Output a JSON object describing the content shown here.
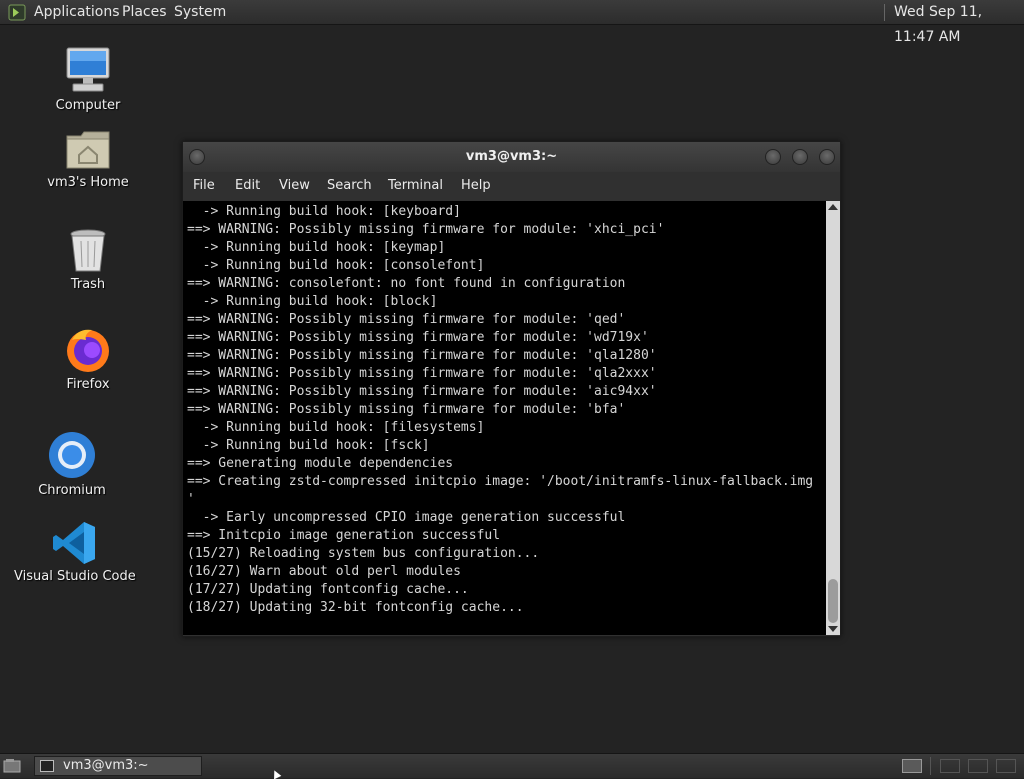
{
  "top_panel": {
    "menus": [
      "Applications",
      "Places",
      "System"
    ],
    "clock": "Wed Sep 11, 11:47 AM"
  },
  "desktop": {
    "icons": [
      {
        "label": "Computer",
        "icon": "computer-icon"
      },
      {
        "label": "vm3's Home",
        "icon": "home-folder-icon"
      },
      {
        "label": "Trash",
        "icon": "trash-icon"
      },
      {
        "label": "Firefox",
        "icon": "firefox-icon"
      },
      {
        "label": "Chromium",
        "icon": "chromium-icon"
      },
      {
        "label": "Visual Studio Code",
        "icon": "vscode-icon"
      }
    ]
  },
  "terminal": {
    "title": "vm3@vm3:~",
    "menu": [
      "File",
      "Edit",
      "View",
      "Search",
      "Terminal",
      "Help"
    ],
    "lines": [
      "  -> Running build hook: [keyboard]",
      "==> WARNING: Possibly missing firmware for module: 'xhci_pci'",
      "  -> Running build hook: [keymap]",
      "  -> Running build hook: [consolefont]",
      "==> WARNING: consolefont: no font found in configuration",
      "  -> Running build hook: [block]",
      "==> WARNING: Possibly missing firmware for module: 'qed'",
      "==> WARNING: Possibly missing firmware for module: 'wd719x'",
      "==> WARNING: Possibly missing firmware for module: 'qla1280'",
      "==> WARNING: Possibly missing firmware for module: 'qla2xxx'",
      "==> WARNING: Possibly missing firmware for module: 'aic94xx'",
      "==> WARNING: Possibly missing firmware for module: 'bfa'",
      "  -> Running build hook: [filesystems]",
      "  -> Running build hook: [fsck]",
      "==> Generating module dependencies",
      "==> Creating zstd-compressed initcpio image: '/boot/initramfs-linux-fallback.img",
      "'",
      "  -> Early uncompressed CPIO image generation successful",
      "==> Initcpio image generation successful",
      "(15/27) Reloading system bus configuration...",
      "(16/27) Warn about old perl modules",
      "(17/27) Updating fontconfig cache...",
      "(18/27) Updating 32-bit fontconfig cache..."
    ]
  },
  "taskbar": {
    "task_label": "vm3@vm3:~"
  },
  "colors": {
    "desktop_bg": "#232323",
    "terminal_bg": "#000000",
    "terminal_fg": "#d6d6d6"
  }
}
